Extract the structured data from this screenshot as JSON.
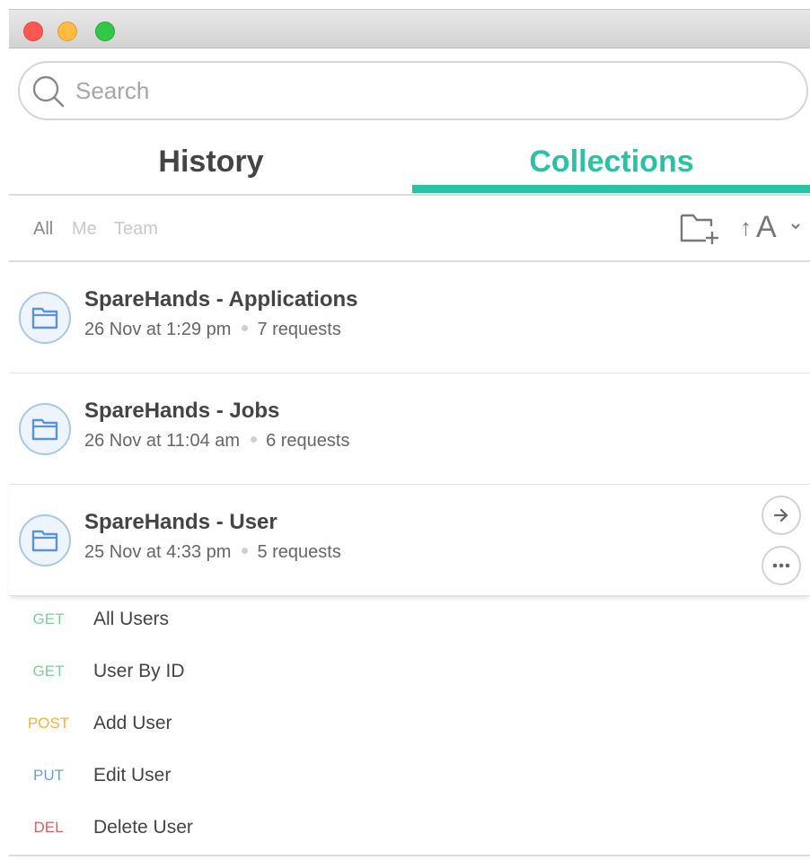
{
  "search": {
    "placeholder": "Search"
  },
  "tabs": [
    {
      "label": "History",
      "active": false
    },
    {
      "label": "Collections",
      "active": true
    }
  ],
  "filters": {
    "all": "All",
    "me": "Me",
    "team": "Team"
  },
  "sort": {
    "label": "A"
  },
  "collections": [
    {
      "name": "SpareHands - Applications",
      "date": "26 Nov at 1:29 pm",
      "requests": "7 requests"
    },
    {
      "name": "SpareHands - Jobs",
      "date": "26 Nov at 11:04 am",
      "requests": "6 requests"
    },
    {
      "name": "SpareHands - User",
      "date": "25 Nov at 4:33 pm",
      "requests": "5 requests",
      "expanded": true
    }
  ],
  "requests": [
    {
      "method": "GET",
      "name": "All Users",
      "color": "#7ccf9b"
    },
    {
      "method": "GET",
      "name": "User By ID",
      "color": "#7ccf9b"
    },
    {
      "method": "POST",
      "name": "Add User",
      "color": "#f4b23f"
    },
    {
      "method": "PUT",
      "name": "Edit User",
      "color": "#6a9fd8"
    },
    {
      "method": "DEL",
      "name": "Delete User",
      "color": "#e65a5a"
    }
  ],
  "colors": {
    "accent": "#2bc1a3",
    "folder": "#5a94d6"
  }
}
